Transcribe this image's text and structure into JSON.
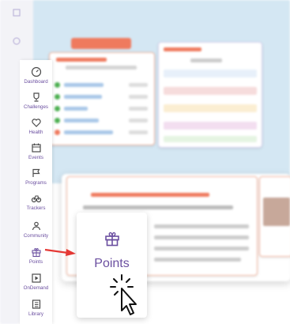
{
  "sidebar": {
    "items": [
      {
        "label": "Dashboard",
        "icon": "gauge-icon"
      },
      {
        "label": "Challenges",
        "icon": "trophy-icon"
      },
      {
        "label": "Health",
        "icon": "heart-icon"
      },
      {
        "label": "Events",
        "icon": "calendar-icon"
      },
      {
        "label": "Programs",
        "icon": "flag-icon"
      },
      {
        "label": "Trackers",
        "icon": "trackers-icon"
      },
      {
        "label": "Community",
        "icon": "community-icon"
      },
      {
        "label": "Points",
        "icon": "gift-icon"
      },
      {
        "label": "OnDemand",
        "icon": "play-square-icon"
      },
      {
        "label": "Library",
        "icon": "book-icon"
      }
    ]
  },
  "highlight": {
    "label": "Points",
    "icon": "gift-icon"
  },
  "colors": {
    "brand_purple": "#6b4fa0",
    "accent_orange": "#ef7a5e",
    "arrow_red": "#e53935",
    "sky": "#d4e7f3"
  }
}
